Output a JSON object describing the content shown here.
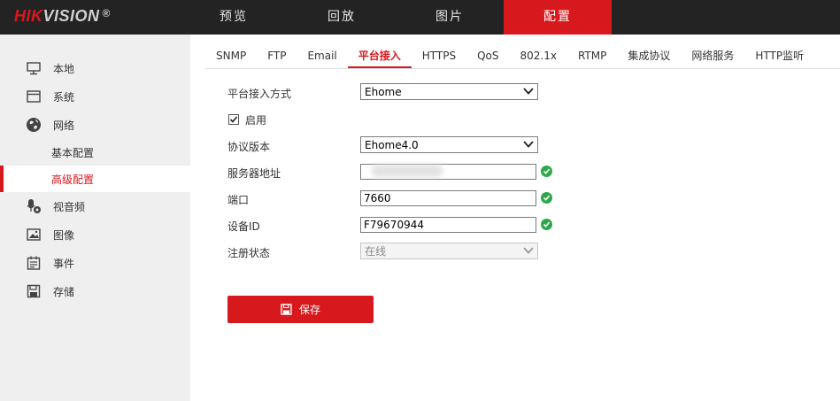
{
  "brand": {
    "name_red": "HIKVISION",
    "registered": "®"
  },
  "nav": [
    "预览",
    "回放",
    "图片",
    "配置"
  ],
  "sidebar": {
    "items": [
      {
        "label": "本地",
        "icon": "monitor-icon"
      },
      {
        "label": "系统",
        "icon": "system-window-icon"
      },
      {
        "label": "网络",
        "icon": "globe-icon"
      },
      {
        "label": "视音频",
        "icon": "camera-mic-icon"
      },
      {
        "label": "图像",
        "icon": "image-icon"
      },
      {
        "label": "事件",
        "icon": "calendar-icon"
      },
      {
        "label": "存储",
        "icon": "save-disk-icon"
      }
    ],
    "network_sub": [
      "基本配置",
      "高级配置"
    ]
  },
  "tabs": [
    "SNMP",
    "FTP",
    "Email",
    "平台接入",
    "HTTPS",
    "QoS",
    "802.1x",
    "RTMP",
    "集成协议",
    "网络服务",
    "HTTP监听"
  ],
  "form": {
    "access_mode_label": "平台接入方式",
    "access_mode_value": "Ehome",
    "enable_label": "启用",
    "enable_checked": true,
    "protocol_label": "协议版本",
    "protocol_value": "Ehome4.0",
    "server_label": "服务器地址",
    "server_value": "",
    "port_label": "端口",
    "port_value": "7660",
    "device_id_label": "设备ID",
    "device_id_value": "F79670944",
    "status_label": "注册状态",
    "status_value": "在线"
  },
  "save_label": "保存",
  "colors": {
    "accent": "#d7191e",
    "topbar": "#232323",
    "sidebar": "#efefef",
    "ok": "#2ea84a"
  }
}
